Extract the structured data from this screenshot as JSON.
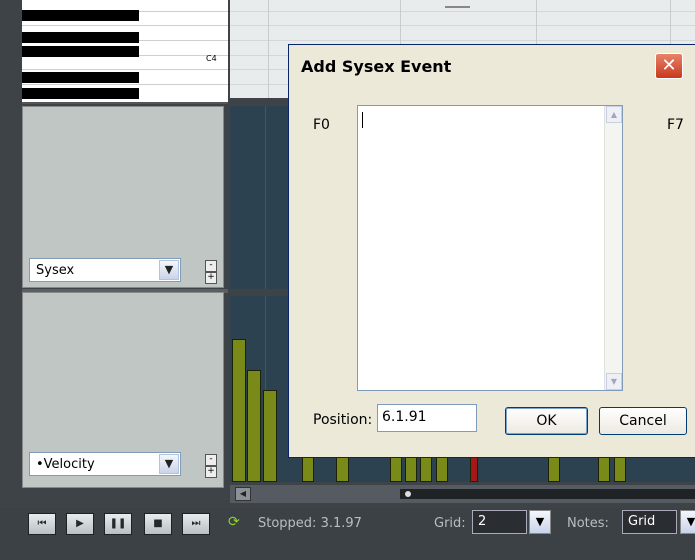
{
  "piano": {
    "c_label": "C4"
  },
  "lanes": {
    "sysex_select": "Sysex",
    "velocity_select": "•Velocity",
    "minus_glyph": "-",
    "plus_glyph": "+"
  },
  "dialog": {
    "title": "Add Sysex Event",
    "close_glyph": "✕",
    "prefix_label": "F0",
    "suffix_label": "F7",
    "sysex_text": "",
    "position_label": "Position:",
    "position_value": "6.1.91",
    "ok_label": "OK",
    "cancel_label": "Cancel"
  },
  "transport": {
    "loop_glyph": "⟳",
    "status": "Stopped: 3.1.97",
    "grid_label": "Grid:",
    "grid_value": "2",
    "notes_label": "Notes:",
    "notes_value": "Grid"
  },
  "colors": {
    "velocity_bar": "#7a8a18",
    "velocity_bar_selected": "#a41818",
    "lane_background": "#2d4250",
    "dialog_background": "#ece9d8"
  }
}
